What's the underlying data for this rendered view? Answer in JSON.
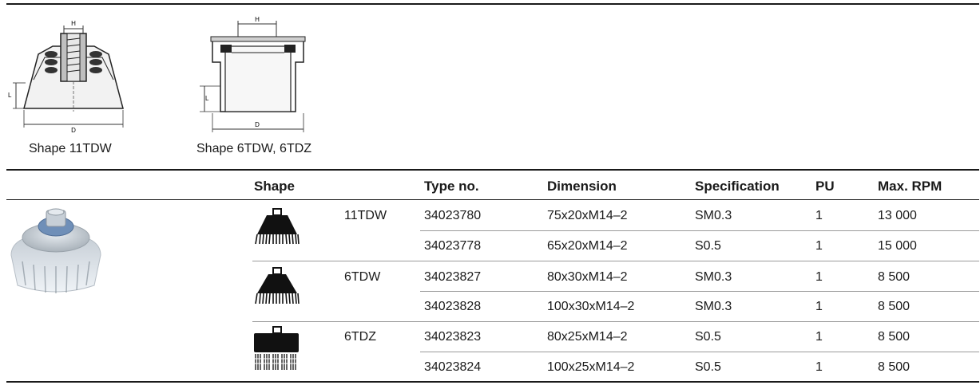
{
  "captions": {
    "shape_11": "Shape 11TDW",
    "shape_6": "Shape 6TDW, 6TDZ"
  },
  "dim_labels": {
    "h": "H",
    "l": "L",
    "d": "D"
  },
  "headers": {
    "shape": "Shape",
    "type_no": "Type no.",
    "dimension": "Dimension",
    "specification": "Specification",
    "pu": "PU",
    "max_rpm": "Max. RPM"
  },
  "rows": [
    {
      "shape": "11TDW",
      "type_no": "34023780",
      "dimension": "75x20xM14–2",
      "specification": "SM0.3",
      "pu": "1",
      "max_rpm": "13 000"
    },
    {
      "shape": "",
      "type_no": "34023778",
      "dimension": "65x20xM14–2",
      "specification": "S0.5",
      "pu": "1",
      "max_rpm": "15 000"
    },
    {
      "shape": "6TDW",
      "type_no": "34023827",
      "dimension": "80x30xM14–2",
      "specification": "SM0.3",
      "pu": "1",
      "max_rpm": "8 500"
    },
    {
      "shape": "",
      "type_no": "34023828",
      "dimension": "100x30xM14–2",
      "specification": "SM0.3",
      "pu": "1",
      "max_rpm": "8 500"
    },
    {
      "shape": "6TDZ",
      "type_no": "34023823",
      "dimension": "80x25xM14–2",
      "specification": "S0.5",
      "pu": "1",
      "max_rpm": "8 500"
    },
    {
      "shape": "",
      "type_no": "34023824",
      "dimension": "100x25xM14–2",
      "specification": "S0.5",
      "pu": "1",
      "max_rpm": "8 500"
    }
  ]
}
